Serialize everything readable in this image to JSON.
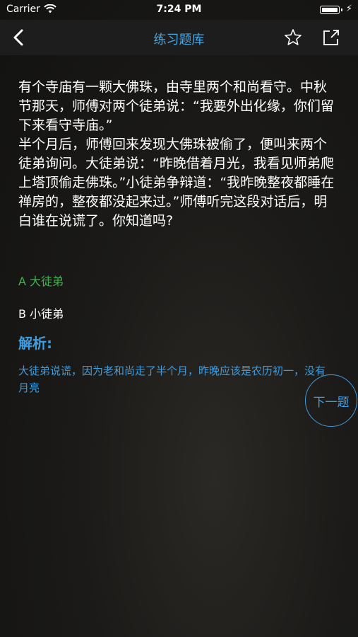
{
  "status_bar": {
    "carrier": "Carrier",
    "time": "7:24 PM",
    "charge_symbol": "⚡"
  },
  "nav": {
    "title": "练习题库",
    "back_icon": "chevron-left-icon",
    "favorite_icon": "star-outline-icon",
    "share_icon": "share-external-icon",
    "accent_color": "#4aa6e0"
  },
  "question": {
    "text": "有个寺庙有一颗大佛珠，由寺里两个和尚看守。中秋节那天，师傅对两个徒弟说：“我要外出化缘，你们留下来看守寺庙。”\n半个月后，师傅回来发现大佛珠被偷了，便叫来两个徒弟询问。大徒弟说：“昨晚借着月光，我看见师弟爬上塔顶偷走佛珠。”小徒弟争辩道：“我昨晚整夜都睡在禅房的，整夜都没起来过。”师傅听完这段对话后，明白谁在说谎了。你知道吗?"
  },
  "options": [
    {
      "label": "A 大徒弟",
      "state": "correct",
      "color": "#3fb34f"
    },
    {
      "label": "B 小徒弟",
      "state": "normal",
      "color": "#ffffff"
    }
  ],
  "analysis": {
    "title": "解析:",
    "text": "大徒弟说谎，因为老和尚走了半个月，昨晚应该是农历初一，没有月亮",
    "color": "#3d9de0"
  },
  "next_button": {
    "label": "下一题"
  }
}
